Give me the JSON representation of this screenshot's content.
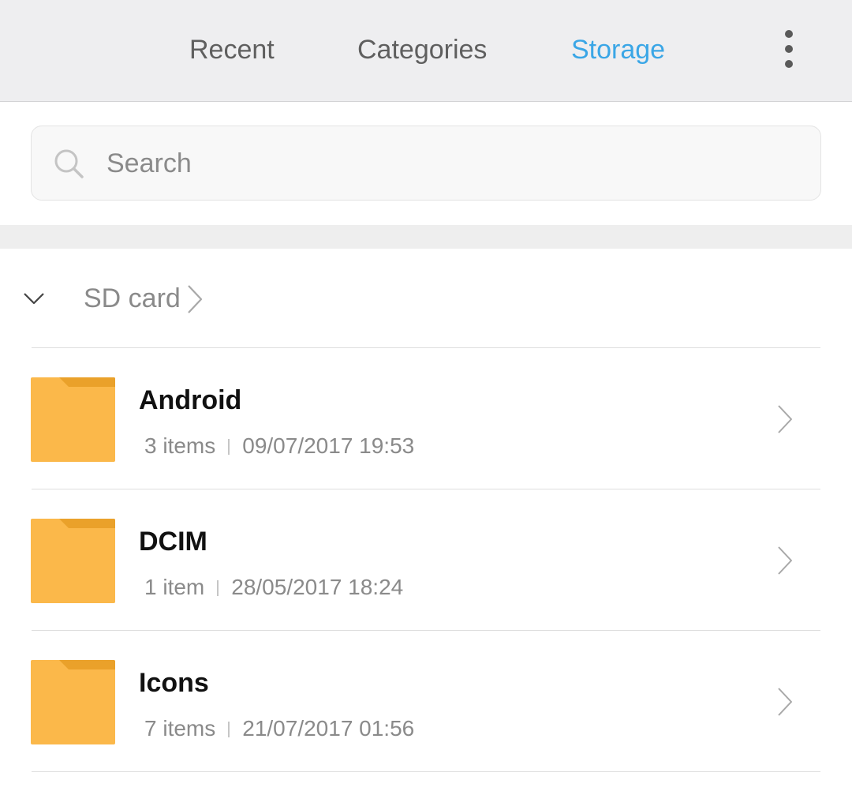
{
  "tabs": [
    {
      "label": "Recent",
      "active": false
    },
    {
      "label": "Categories",
      "active": false
    },
    {
      "label": "Storage",
      "active": true
    }
  ],
  "more_icon": "more-vertical-icon",
  "search": {
    "placeholder": "Search",
    "value": "",
    "icon": "search-icon"
  },
  "breadcrumb": {
    "label": "SD card",
    "expanded": true
  },
  "folders": [
    {
      "name": "Android",
      "count": "3 items",
      "modified": "09/07/2017 19:53"
    },
    {
      "name": "DCIM",
      "count": "1 item",
      "modified": "28/05/2017 18:24"
    },
    {
      "name": "Icons",
      "count": "7 items",
      "modified": "21/07/2017 01:56"
    }
  ],
  "colors": {
    "accent": "#3aa6e6",
    "topbar_bg": "#eeeef0",
    "folder_body": "#fbb84a",
    "folder_tab": "#eaa12a",
    "text_primary": "#111111",
    "text_secondary": "#8a8a8a"
  }
}
